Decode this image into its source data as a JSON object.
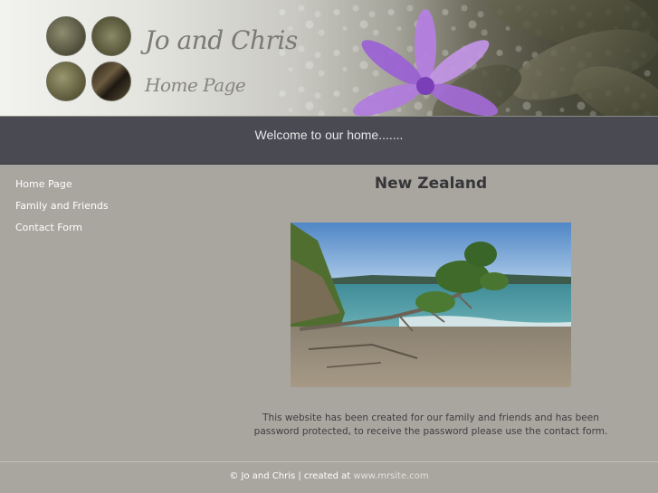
{
  "header": {
    "site_title": "Jo and Chris",
    "site_subtitle": "Home Page"
  },
  "welcome": {
    "text": "Welcome to our home......."
  },
  "sidebar": {
    "items": [
      {
        "label": "Home Page"
      },
      {
        "label": "Family and Friends"
      },
      {
        "label": "Contact Form"
      }
    ]
  },
  "main": {
    "heading": "New Zealand",
    "intro_line1": "This website has been created for our family and friends and has been",
    "intro_line2": "password protected, to receive the password please use the contact form."
  },
  "footer": {
    "copyright": "© Jo and Chris | created at ",
    "link_text": "www.mrsite.com"
  },
  "colors": {
    "background": "#a9a69f",
    "welcome_bar": "#4a4a52",
    "heading": "#36363a"
  }
}
